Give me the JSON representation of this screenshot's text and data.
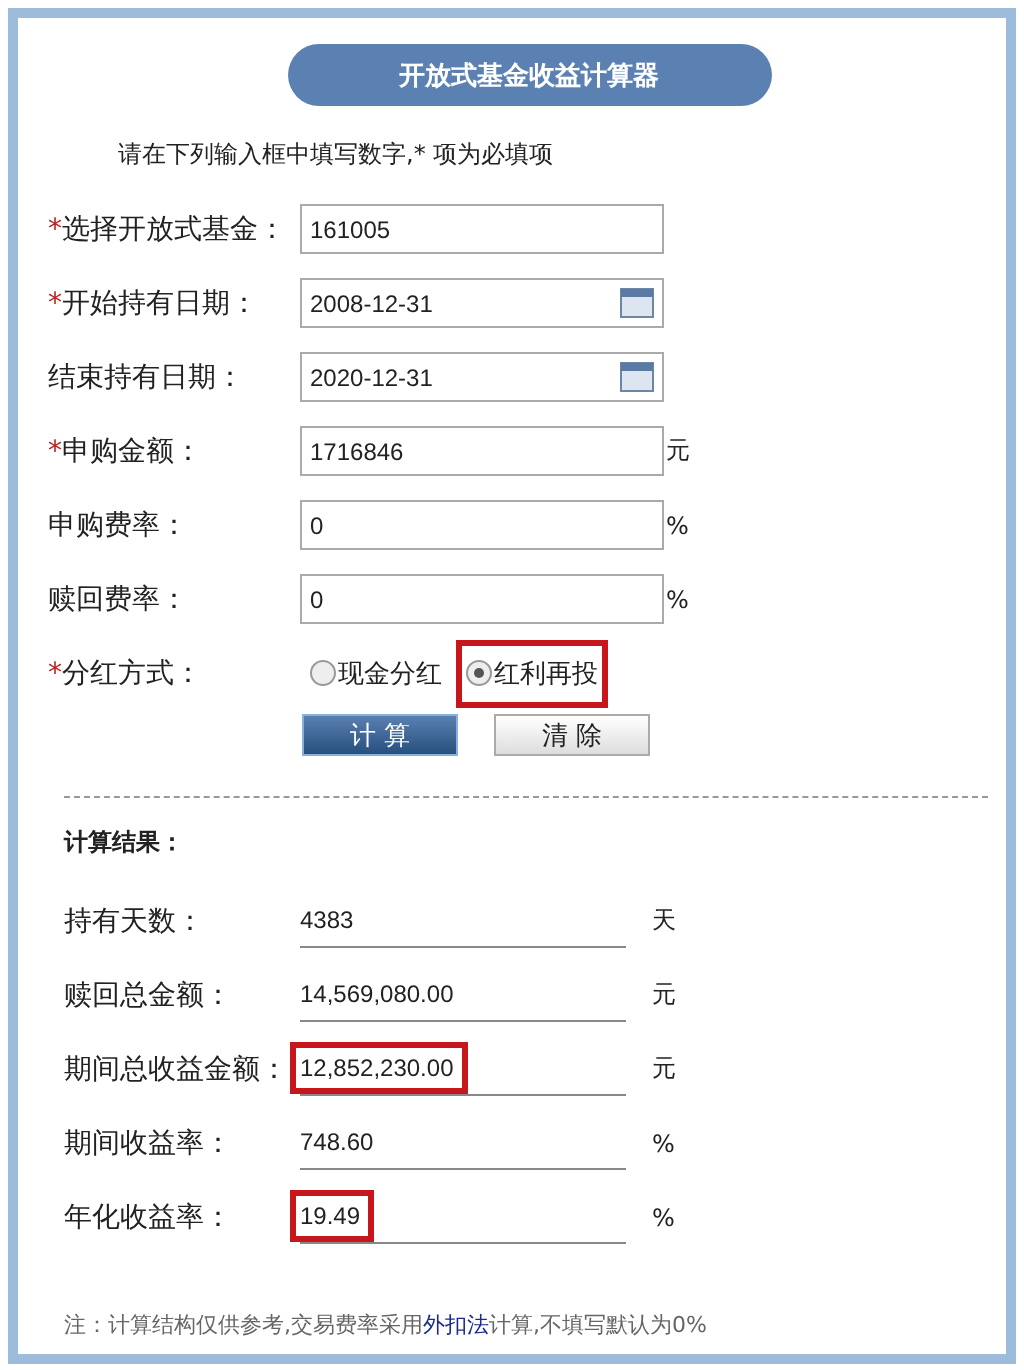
{
  "title": "开放式基金收益计算器",
  "instruction": "请在下列输入框中填写数字,* 项为必填项",
  "fields": [
    {
      "kind": "text",
      "required_mark": "*",
      "label": "选择开放式基金：",
      "value": "161005"
    },
    {
      "kind": "date",
      "required_mark": "*",
      "label": "开始持有日期：",
      "value": "2008-12-31"
    },
    {
      "kind": "date",
      "label": "结束持有日期：",
      "value": "2020-12-31"
    },
    {
      "kind": "text",
      "required_mark": "*",
      "label": "申购金额：",
      "value": "1716846",
      "unit": "元"
    },
    {
      "kind": "text",
      "label": "申购费率：",
      "value": "0",
      "unit": "%"
    },
    {
      "kind": "text",
      "label": "赎回费率：",
      "value": "0",
      "unit": "%"
    },
    {
      "kind": "radio",
      "required_mark": "*",
      "label": "分红方式：",
      "options": [
        {
          "label": "现金分红",
          "selected": false,
          "highlighted": false
        },
        {
          "label": "红利再投",
          "selected": true,
          "highlighted": true
        }
      ]
    }
  ],
  "buttons": [
    {
      "label": "计 算",
      "kind": "primary"
    },
    {
      "label": "清 除",
      "kind": "secondary"
    }
  ],
  "results_title": "计算结果：",
  "results": [
    {
      "label": "持有天数：",
      "value": "4383",
      "unit": "天",
      "highlighted": false
    },
    {
      "label": "赎回总金额：",
      "value": "14,569,080.00",
      "unit": "元",
      "highlighted": false
    },
    {
      "label": "期间总收益金额：",
      "value": "12,852,230.00",
      "unit": "元",
      "highlighted": true
    },
    {
      "label": "期间收益率：",
      "value": "748.60",
      "unit": "%",
      "highlighted": false
    },
    {
      "label": "年化收益率：",
      "value": "19.49",
      "unit": "%",
      "highlighted": true
    }
  ],
  "note": {
    "before": "注：计算结构仅供参考,交易费率采用",
    "link": "外扣法",
    "after": "计算,不填写默认为0%"
  }
}
